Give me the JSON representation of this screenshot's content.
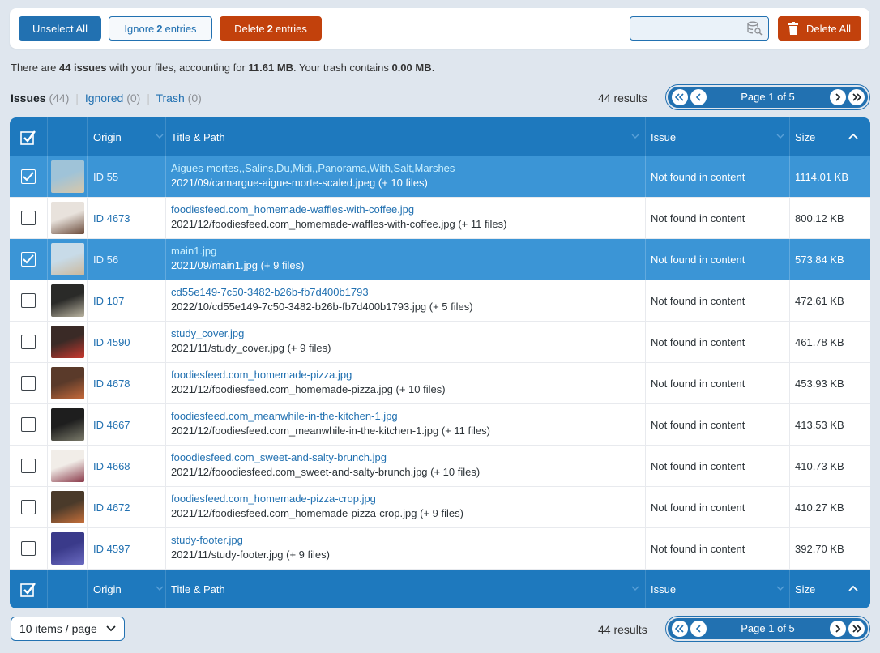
{
  "toolbar": {
    "unselect_all": "Unselect All",
    "ignore_prefix": "Ignore",
    "ignore_count": "2",
    "ignore_suffix": "entries",
    "delete_prefix": "Delete",
    "delete_count": "2",
    "delete_suffix": "entries",
    "search_placeholder": "",
    "delete_all": "Delete All"
  },
  "summary": {
    "p1": "There are ",
    "issues": "44 issues",
    "p2": " with your files, accounting for ",
    "size": "11.61 MB",
    "p3": ". Your trash contains ",
    "trash": "0.00 MB",
    "p4": "."
  },
  "tabs": {
    "issues_label": "Issues",
    "issues_count": "(44)",
    "ignored_label": "Ignored",
    "ignored_count": "(0)",
    "trash_label": "Trash",
    "trash_count": "(0)"
  },
  "pagination": {
    "results": "44 results",
    "page_label": "Page 1 of 5"
  },
  "columns": {
    "origin": "Origin",
    "title_path": "Title & Path",
    "issue": "Issue",
    "size": "Size"
  },
  "rows": [
    {
      "selected": true,
      "id": "ID 55",
      "title": "Aigues-mortes,,Salins,Du,Midi,,Panorama,With,Salt,Marshes",
      "path": "2021/09/camargue-aigue-morte-scaled.jpeg (+ 10 files)",
      "issue": "Not found in content",
      "size": "1114.01 KB",
      "thumb": [
        "#9fc3d8",
        "#d9c7a8"
      ]
    },
    {
      "selected": false,
      "id": "ID 4673",
      "title": "foodiesfeed.com_homemade-waffles-with-coffee.jpg",
      "path": "2021/12/foodiesfeed.com_homemade-waffles-with-coffee.jpg (+ 11 files)",
      "issue": "Not found in content",
      "size": "800.12 KB",
      "thumb": [
        "#e8e2dc",
        "#6a4a3a"
      ]
    },
    {
      "selected": true,
      "id": "ID 56",
      "title": "main1.jpg",
      "path": "2021/09/main1.jpg (+ 9 files)",
      "issue": "Not found in content",
      "size": "573.84 KB",
      "thumb": [
        "#c8dbe8",
        "#cbb79a"
      ]
    },
    {
      "selected": false,
      "id": "ID 107",
      "title": "cd55e149-7c50-3482-b26b-fb7d400b1793",
      "path": "2022/10/cd55e149-7c50-3482-b26b-fb7d400b1793.jpg (+ 5 files)",
      "issue": "Not found in content",
      "size": "472.61 KB",
      "thumb": [
        "#2a2a28",
        "#b9b3a0"
      ]
    },
    {
      "selected": false,
      "id": "ID 4590",
      "title": "study_cover.jpg",
      "path": "2021/11/study_cover.jpg (+ 9 files)",
      "issue": "Not found in content",
      "size": "461.78 KB",
      "thumb": [
        "#3a2a26",
        "#c9382e"
      ]
    },
    {
      "selected": false,
      "id": "ID 4678",
      "title": "foodiesfeed.com_homemade-pizza.jpg",
      "path": "2021/12/foodiesfeed.com_homemade-pizza.jpg (+ 10 files)",
      "issue": "Not found in content",
      "size": "453.93 KB",
      "thumb": [
        "#5a3a2a",
        "#c86a3a"
      ]
    },
    {
      "selected": false,
      "id": "ID 4667",
      "title": "foodiesfeed.com_meanwhile-in-the-kitchen-1.jpg",
      "path": "2021/12/foodiesfeed.com_meanwhile-in-the-kitchen-1.jpg (+ 11 files)",
      "issue": "Not found in content",
      "size": "413.53 KB",
      "thumb": [
        "#1e1e1e",
        "#7a7a6a"
      ]
    },
    {
      "selected": false,
      "id": "ID 4668",
      "title": "fooodiesfeed.com_sweet-and-salty-brunch.jpg",
      "path": "2021/12/fooodiesfeed.com_sweet-and-salty-brunch.jpg (+ 10 files)",
      "issue": "Not found in content",
      "size": "410.73 KB",
      "thumb": [
        "#f1ede8",
        "#8a3a4a"
      ]
    },
    {
      "selected": false,
      "id": "ID 4672",
      "title": "foodiesfeed.com_homemade-pizza-crop.jpg",
      "path": "2021/12/foodiesfeed.com_homemade-pizza-crop.jpg (+ 9 files)",
      "issue": "Not found in content",
      "size": "410.27 KB",
      "thumb": [
        "#4a3a2a",
        "#c8703a"
      ]
    },
    {
      "selected": false,
      "id": "ID 4597",
      "title": "study-footer.jpg",
      "path": "2021/11/study-footer.jpg (+ 9 files)",
      "issue": "Not found in content",
      "size": "392.70 KB",
      "thumb": [
        "#3a3a8a",
        "#6a6ac0"
      ]
    }
  ],
  "footer": {
    "per_page": "10 items / page",
    "results": "44 results",
    "page_label": "Page 1 of 5"
  },
  "colors": {
    "primary": "#2271b1",
    "header": "#1e79be",
    "selected_row": "#3b95d6",
    "danger": "#c2410c"
  }
}
